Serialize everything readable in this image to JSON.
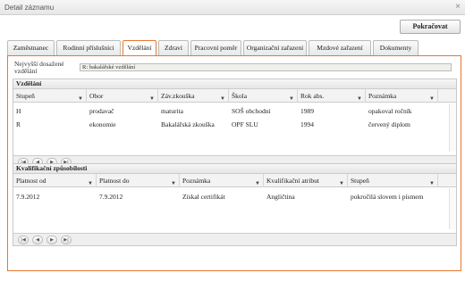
{
  "window": {
    "title": "Detail záznamu",
    "close_icon": "×"
  },
  "toolbar": {
    "continue_label": "Pokračovat"
  },
  "tabs": [
    {
      "label": "Zaměstnanec"
    },
    {
      "label": "Rodinní příslušníci"
    },
    {
      "label": "Vzdělání"
    },
    {
      "label": "Zdraví"
    },
    {
      "label": "Pracovní poměr"
    },
    {
      "label": "Organizační zařazení"
    },
    {
      "label": "Mzdové zařazení"
    },
    {
      "label": "Dokumenty"
    }
  ],
  "active_tab": "Vzdělání",
  "highest_education": {
    "label": "Nejvyšší dosažené vzdělání",
    "value": "R: bakalářské vzdělání"
  },
  "education": {
    "title": "Vzdělání",
    "columns": [
      "Stupeň",
      "Obor",
      "Záv.zkouška",
      "Škola",
      "Rok abs.",
      "Poznámka"
    ],
    "rows": [
      [
        "H",
        "prodavač",
        "maturita",
        "SOŠ obchodní",
        "1989",
        "opakoval ročník"
      ],
      [
        "R",
        "ekonomie",
        "Bakalářská zkouška",
        "OPF SLU",
        "1994",
        "červený diplom"
      ]
    ]
  },
  "qualifications": {
    "title": "Kvalifikační způsobilosti",
    "columns": [
      "Platnost od",
      "Platnost do",
      "Poznámka",
      "Kvalifikační atribut",
      "Stupeň"
    ],
    "rows": [
      [
        "7.9.2012",
        "7.9.2012",
        "Získal certifikát",
        "Angličtina",
        "pokročilá slovem i písmem"
      ]
    ]
  },
  "pager": {
    "first": "|◀",
    "prev": "◀",
    "next": "▶",
    "last": "▶|"
  },
  "filter_icon": "▼",
  "accent_color": "#e8772e"
}
